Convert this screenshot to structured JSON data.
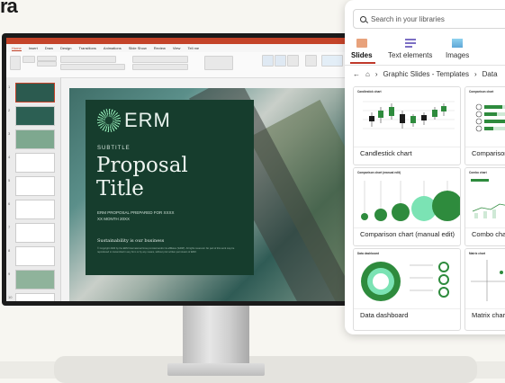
{
  "corner_logo": "ra",
  "ppt": {
    "tabs": [
      "Home",
      "Insert",
      "Draw",
      "Design",
      "Transitions",
      "Animations",
      "Slide Show",
      "Review",
      "View",
      "Tell me"
    ],
    "active_tab": "Home",
    "slide_numbers": [
      "1",
      "2",
      "3",
      "4",
      "5",
      "6",
      "7",
      "8",
      "9",
      "10"
    ]
  },
  "slide": {
    "brand": "ERM",
    "subtitle": "SUBTITLE",
    "title_line1": "Proposal",
    "title_line2": "Title",
    "prepared_for": "ERM PROPOSAL PREPARED FOR XXXX",
    "date": "XX MONTH 20XX",
    "tagline": "Sustainability is our business",
    "legal": "© Copyright 2020 by the ERM International Group Limited and/or its affiliates ('ERM'). All rights reserved. No part of this work may be reproduced or transmitted in any form or by any means, without prior written permission of ERM."
  },
  "library": {
    "search_placeholder": "Search in your libraries",
    "tabs": [
      {
        "label": "Slides",
        "icon": "slides-icon"
      },
      {
        "label": "Text elements",
        "icon": "text-elements-icon"
      },
      {
        "label": "Images",
        "icon": "images-icon"
      }
    ],
    "active_tab": "Slides",
    "breadcrumb": [
      "Graphic Slides - Templates",
      "Data"
    ],
    "cards": [
      {
        "label": "Candlestick chart",
        "preview_title": "Candlestick chart"
      },
      {
        "label": "Comparison c",
        "preview_title": "Comparison chart"
      },
      {
        "label": "Comparison chart (manual edit)",
        "preview_title": "Comparison chart (manual edit)"
      },
      {
        "label": "Combo chart",
        "preview_title": "Combo chart"
      },
      {
        "label": "Data dashboard",
        "preview_title": "Data dashboard"
      },
      {
        "label": "Matrix chart",
        "preview_title": "Matrix chart"
      }
    ]
  },
  "colors": {
    "accent_red": "#c0392b",
    "erm_green": "#163d2d",
    "chart_green": "#2e8b3d",
    "mint": "#7be3b4"
  }
}
